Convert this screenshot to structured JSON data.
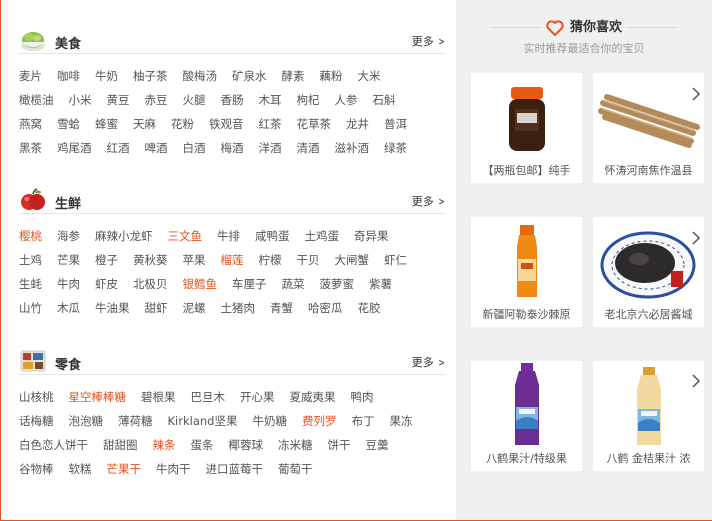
{
  "categories": [
    {
      "title": "美食",
      "more": "更多",
      "icon": "vegetable-bowl-icon",
      "rows": [
        [
          {
            "t": "麦片"
          },
          {
            "t": "咖啡"
          },
          {
            "t": "牛奶"
          },
          {
            "t": "柚子茶"
          },
          {
            "t": "酸梅汤"
          },
          {
            "t": "矿泉水"
          },
          {
            "t": "酵素"
          },
          {
            "t": "藕粉"
          },
          {
            "t": "大米"
          }
        ],
        [
          {
            "t": "橄榄油"
          },
          {
            "t": "小米"
          },
          {
            "t": "黄豆"
          },
          {
            "t": "赤豆"
          },
          {
            "t": "火腿"
          },
          {
            "t": "香肠"
          },
          {
            "t": "木耳"
          },
          {
            "t": "枸杞"
          },
          {
            "t": "人参"
          },
          {
            "t": "石斛"
          }
        ],
        [
          {
            "t": "燕窝"
          },
          {
            "t": "雪蛤"
          },
          {
            "t": "蜂蜜"
          },
          {
            "t": "天麻"
          },
          {
            "t": "花粉"
          },
          {
            "t": "铁观音"
          },
          {
            "t": "红茶"
          },
          {
            "t": "花草茶"
          },
          {
            "t": "龙井"
          },
          {
            "t": "普洱"
          }
        ],
        [
          {
            "t": "黑茶"
          },
          {
            "t": "鸡尾酒"
          },
          {
            "t": "红酒"
          },
          {
            "t": "啤酒"
          },
          {
            "t": "白酒"
          },
          {
            "t": "梅酒"
          },
          {
            "t": "洋酒"
          },
          {
            "t": "清酒"
          },
          {
            "t": "滋补酒"
          },
          {
            "t": "绿茶"
          }
        ]
      ]
    },
    {
      "title": "生鲜",
      "more": "更多",
      "icon": "apple-icon",
      "rows": [
        [
          {
            "t": "樱桃",
            "hot": true
          },
          {
            "t": "海参"
          },
          {
            "t": "麻辣小龙虾"
          },
          {
            "t": "三文鱼",
            "hot": true
          },
          {
            "t": "牛排"
          },
          {
            "t": "咸鸭蛋"
          },
          {
            "t": "土鸡蛋"
          },
          {
            "t": "奇异果"
          }
        ],
        [
          {
            "t": "土鸡"
          },
          {
            "t": "芒果"
          },
          {
            "t": "橙子"
          },
          {
            "t": "黄秋葵"
          },
          {
            "t": "苹果"
          },
          {
            "t": "榴莲",
            "hot": true
          },
          {
            "t": "柠檬"
          },
          {
            "t": "干贝"
          },
          {
            "t": "大闸蟹"
          },
          {
            "t": "虾仁"
          }
        ],
        [
          {
            "t": "生蚝"
          },
          {
            "t": "牛肉"
          },
          {
            "t": "虾皮"
          },
          {
            "t": "北极贝"
          },
          {
            "t": "银鳕鱼",
            "hot": true
          },
          {
            "t": "车厘子"
          },
          {
            "t": "蔬菜"
          },
          {
            "t": "菠萝蜜"
          },
          {
            "t": "紫薯"
          }
        ],
        [
          {
            "t": "山竹"
          },
          {
            "t": "木瓜"
          },
          {
            "t": "牛油果"
          },
          {
            "t": "甜虾"
          },
          {
            "t": "泥螺"
          },
          {
            "t": "土猪肉"
          },
          {
            "t": "青蟹"
          },
          {
            "t": "哈密瓜"
          },
          {
            "t": "花胶"
          }
        ]
      ]
    },
    {
      "title": "零食",
      "more": "更多",
      "icon": "snack-pack-icon",
      "rows": [
        [
          {
            "t": "山核桃"
          },
          {
            "t": "星空棒棒糖",
            "hot": true
          },
          {
            "t": "碧根果"
          },
          {
            "t": "巴旦木"
          },
          {
            "t": "开心果"
          },
          {
            "t": "夏威夷果"
          },
          {
            "t": "鸭肉"
          }
        ],
        [
          {
            "t": "话梅糖"
          },
          {
            "t": "泡泡糖"
          },
          {
            "t": "薄荷糖"
          },
          {
            "t": "Kirkland坚果"
          },
          {
            "t": "牛奶糖"
          },
          {
            "t": "费列罗",
            "hot": true
          },
          {
            "t": "布丁"
          },
          {
            "t": "果冻"
          }
        ],
        [
          {
            "t": "白色恋人饼干"
          },
          {
            "t": "甜甜圈"
          },
          {
            "t": "辣条",
            "hot": true
          },
          {
            "t": "蛋条"
          },
          {
            "t": "椰蓉球"
          },
          {
            "t": "冻米糖"
          },
          {
            "t": "饼干"
          },
          {
            "t": "豆羹"
          }
        ],
        [
          {
            "t": "谷物棒"
          },
          {
            "t": "软糕"
          },
          {
            "t": "芒果干",
            "hot": true
          },
          {
            "t": "牛肉干"
          },
          {
            "t": "进口蓝莓干"
          },
          {
            "t": "葡萄干"
          }
        ]
      ]
    }
  ],
  "recommend": {
    "title": "猜你喜欢",
    "subtitle": "实时推荐最适合你的宝贝",
    "heart_icon": "heart-icon",
    "accent": "#e4531f",
    "next_icon": "chevron-right-icon",
    "items": [
      {
        "name": "【两瓶包邮】纯手",
        "icon": "jar-icon"
      },
      {
        "name": "怀涛河南焦作温县",
        "icon": "yam-bundle-icon"
      },
      {
        "name": "新疆阿勒泰沙棘原",
        "icon": "juice-bottle-icon"
      },
      {
        "name": "老北京六必居酱城",
        "icon": "pickle-plate-icon"
      },
      {
        "name": "八鹤果汁/特级果",
        "icon": "purple-bottle-icon"
      },
      {
        "name": "八鹤 金桔果汁 浓",
        "icon": "yellow-bottle-icon"
      }
    ]
  }
}
